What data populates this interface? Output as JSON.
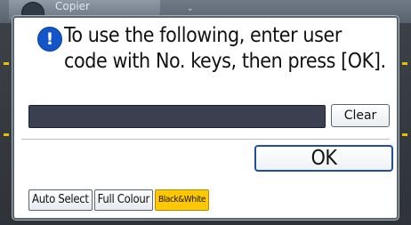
{
  "background": {
    "tab_label": "Copier"
  },
  "dialog": {
    "message": "To use the following, enter user\ncode with No. keys, then press [OK].",
    "clear_label": "Clear",
    "ok_label": "OK"
  },
  "color_modes": [
    {
      "label": "Auto Select",
      "selected": false
    },
    {
      "label": "Full Colour",
      "selected": false
    },
    {
      "label": "Black&White",
      "selected": true
    }
  ],
  "colors": {
    "accent_blue": "#1356c9",
    "selected_yellow": "#ffc800",
    "field_dark": "#3a4050"
  }
}
